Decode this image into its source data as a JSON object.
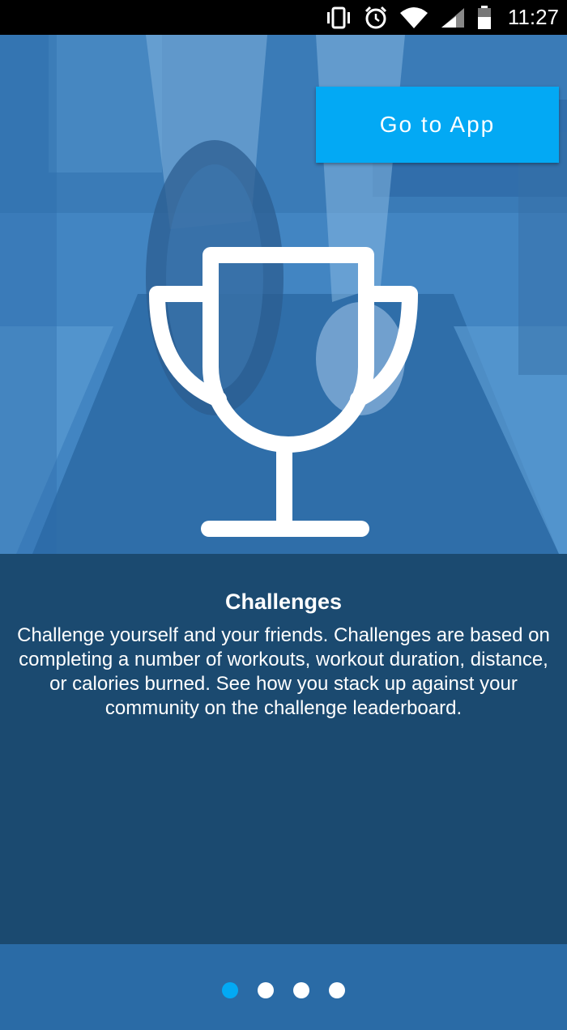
{
  "status_bar": {
    "time": "11:27",
    "icons": [
      "vibrate-icon",
      "alarm-icon",
      "wifi-icon",
      "signal-icon",
      "battery-icon"
    ]
  },
  "header": {
    "go_to_app_label": "Go to App"
  },
  "slide": {
    "icon": "trophy-icon",
    "title": "Challenges",
    "body": "Challenge yourself and your friends. Challenges are based on completing a number of workouts, workout duration, distance, or calories burned. See how you stack up against your community on the challenge leaderboard."
  },
  "pager": {
    "count": 4,
    "active_index": 0
  },
  "colors": {
    "accent": "#03a9f4",
    "panel": "#1b4a70",
    "background": "#2a6ba6"
  }
}
